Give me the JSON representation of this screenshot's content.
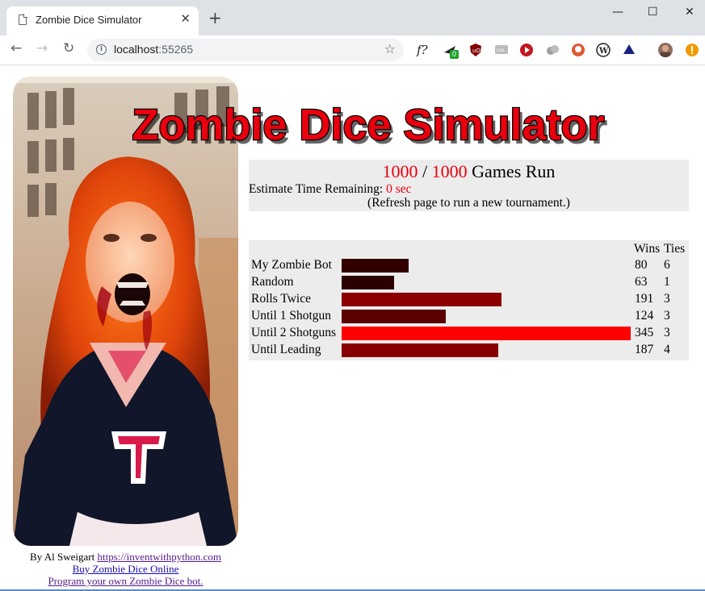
{
  "browser": {
    "tab_title": "Zombie Dice Simulator",
    "url_host": "localhost",
    "url_port": ":55265",
    "new_tab": "+",
    "tab_close": "✕",
    "minimize": "—",
    "maximize": "☐",
    "close": "✕",
    "back": "←",
    "forward": "→",
    "reload": "↻",
    "bookmark_star": "☆",
    "extension_badge": "0",
    "ext_f_label": "f?"
  },
  "header": {
    "logo_text": "Zombie Dice Simulator"
  },
  "status": {
    "games_done": "1000",
    "separator": " / ",
    "games_total": "1000",
    "games_label": " Games Run",
    "estimate_label": "Estimate Time Remaining: ",
    "estimate_value": "0 sec",
    "refresh_note": "(Refresh page to run a new tournament.)"
  },
  "results": {
    "wins_header": "Wins",
    "ties_header": "Ties",
    "max_wins": 345,
    "rows": [
      {
        "name": "My Zombie Bot",
        "wins": "80",
        "ties": "6",
        "color": "#330000"
      },
      {
        "name": "Random",
        "wins": "63",
        "ties": "1",
        "color": "#2a0000"
      },
      {
        "name": "Rolls Twice",
        "wins": "191",
        "ties": "3",
        "color": "#8c0000"
      },
      {
        "name": "Until 1 Shotgun",
        "wins": "124",
        "ties": "3",
        "color": "#5a0000"
      },
      {
        "name": "Until 2 Shotguns",
        "wins": "345",
        "ties": "3",
        "color": "#ff0000"
      },
      {
        "name": "Until Leading",
        "wins": "187",
        "ties": "4",
        "color": "#890000"
      }
    ]
  },
  "credits": {
    "author_prefix": "By Al Sweigart ",
    "author_link": "https://inventwithpython.com",
    "buy_link": "Buy Zombie Dice Online",
    "program_link": "Program your own Zombie Dice bot."
  },
  "colors": {
    "accent_red": "#e8000e",
    "panel_bg": "#ececec"
  }
}
